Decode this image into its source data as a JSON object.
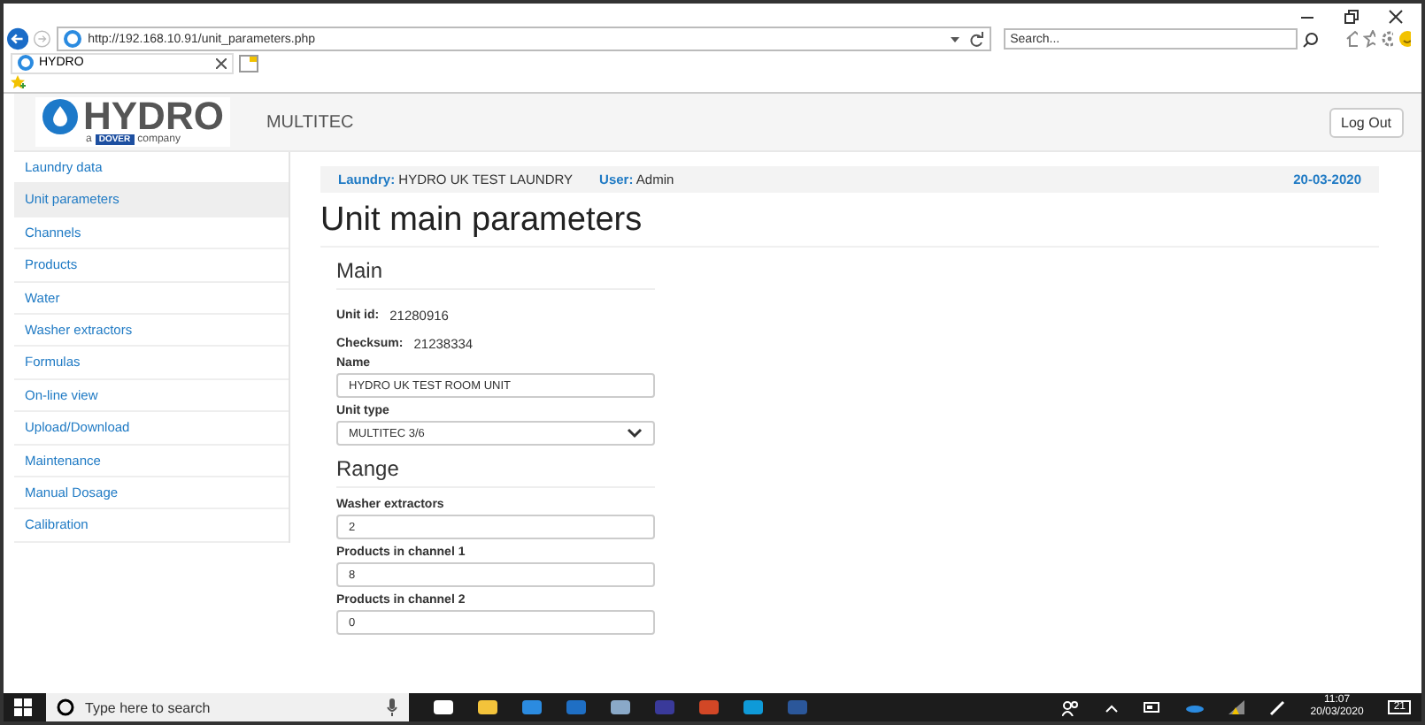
{
  "browser": {
    "address": "http://192.168.10.91/unit_parameters.php",
    "search": {
      "placeholder": "Search..."
    },
    "tabs": [
      {
        "label": "HYDRO",
        "selected": true
      }
    ]
  },
  "header": {
    "logo": {
      "name": "HYDRO",
      "prefix": "a",
      "brand": "DOVER",
      "suffix": "company"
    },
    "product": "MULTITEC",
    "logout": "Log Out"
  },
  "sidebar": {
    "items": [
      {
        "label": "Laundry data",
        "selected": false
      },
      {
        "label": "Unit parameters",
        "selected": true
      },
      {
        "label": "Channels",
        "selected": false
      },
      {
        "label": "Products",
        "selected": false
      },
      {
        "label": "Water",
        "selected": false
      },
      {
        "label": "Washer extractors",
        "selected": false
      },
      {
        "label": "Formulas",
        "selected": false
      },
      {
        "label": "On-line view",
        "selected": false
      },
      {
        "label": "Upload/Download",
        "selected": false
      },
      {
        "label": "Maintenance",
        "selected": false
      },
      {
        "label": "Manual Dosage",
        "selected": false
      },
      {
        "label": "Calibration",
        "selected": false
      }
    ]
  },
  "info_bar": {
    "laundry_label": "Laundry:",
    "laundry": "HYDRO UK TEST LAUNDRY",
    "user_label": "User:",
    "user": "Admin",
    "date": "20-03-2020"
  },
  "title": "Unit main parameters",
  "sections": [
    {
      "heading": "Main",
      "fields": [
        {
          "kind": "readonly",
          "label": "Unit id:",
          "value": "21280916"
        },
        {
          "kind": "readonly",
          "label": "Checksum:",
          "value": "21238334"
        },
        {
          "kind": "input",
          "label": "Name",
          "value": "HYDRO UK TEST ROOM UNIT"
        },
        {
          "kind": "select",
          "label": "Unit type",
          "value": "MULTITEC 3/6"
        }
      ]
    },
    {
      "heading": "Range",
      "fields": [
        {
          "kind": "input",
          "label": "Washer extractors",
          "value": "2"
        },
        {
          "kind": "input",
          "label": "Products in channel 1",
          "value": "8"
        },
        {
          "kind": "input",
          "label": "Products in channel 2",
          "value": "0"
        }
      ]
    }
  ],
  "taskbar": {
    "search": {
      "placeholder": "Type here to search"
    },
    "time": "11:07",
    "date": "20/03/2020",
    "notifications": "21"
  }
}
